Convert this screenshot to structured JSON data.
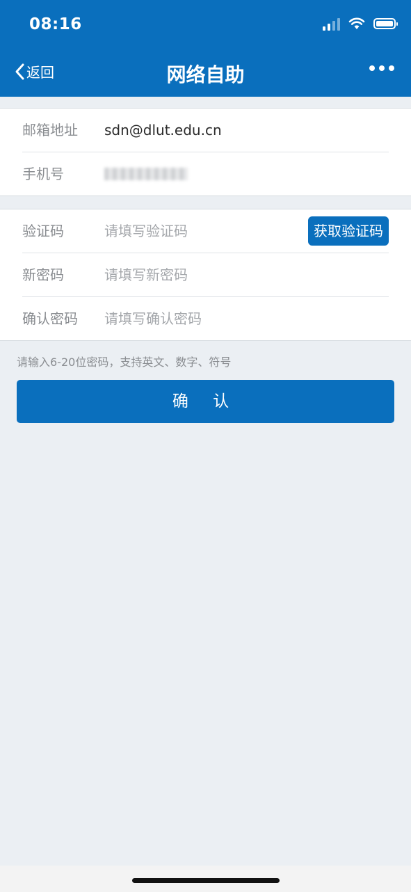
{
  "status_bar": {
    "time": "08:16"
  },
  "nav": {
    "back_label": "返回",
    "title": "网络自助"
  },
  "account": {
    "email_label": "邮箱地址",
    "email_value": "sdn@dlut.edu.cn",
    "phone_label": "手机号"
  },
  "form": {
    "code_label": "验证码",
    "code_placeholder": "请填写验证码",
    "get_code_button": "获取验证码",
    "new_password_label": "新密码",
    "new_password_placeholder": "请填写新密码",
    "confirm_password_label": "确认密码",
    "confirm_password_placeholder": "请填写确认密码"
  },
  "hint": "请输入6-20位密码，支持英文、数字、符号",
  "confirm_button": "确 认",
  "colors": {
    "primary": "#0a6fbd",
    "background": "#ebeff3"
  }
}
